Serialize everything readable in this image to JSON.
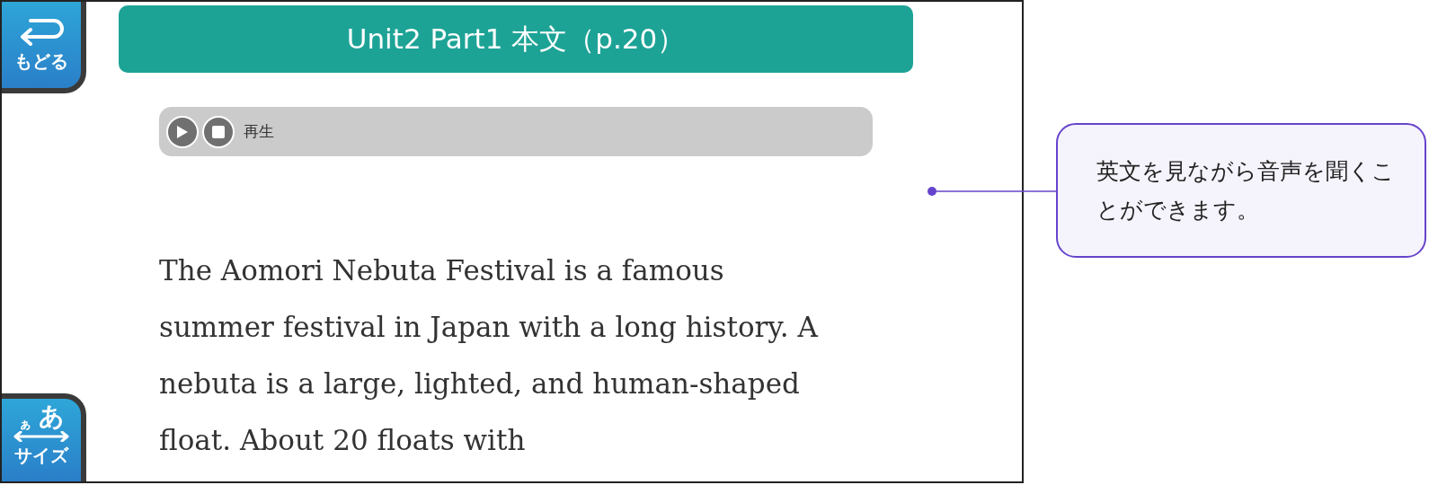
{
  "back_button": {
    "label": "もどる"
  },
  "header": {
    "title": "Unit2 Part1 本文（p.20）"
  },
  "player": {
    "label": "再生"
  },
  "body_text": "The Aomori Nebuta Festival is a famous summer festival in Japan with a long history. A nebuta is a large, lighted, and human-shaped float. About 20 floats with",
  "size_button": {
    "small": "ぁ",
    "large": "あ",
    "label": "サイズ"
  },
  "callout": {
    "text": "英文を見ながら音声を聞くことができます。"
  }
}
